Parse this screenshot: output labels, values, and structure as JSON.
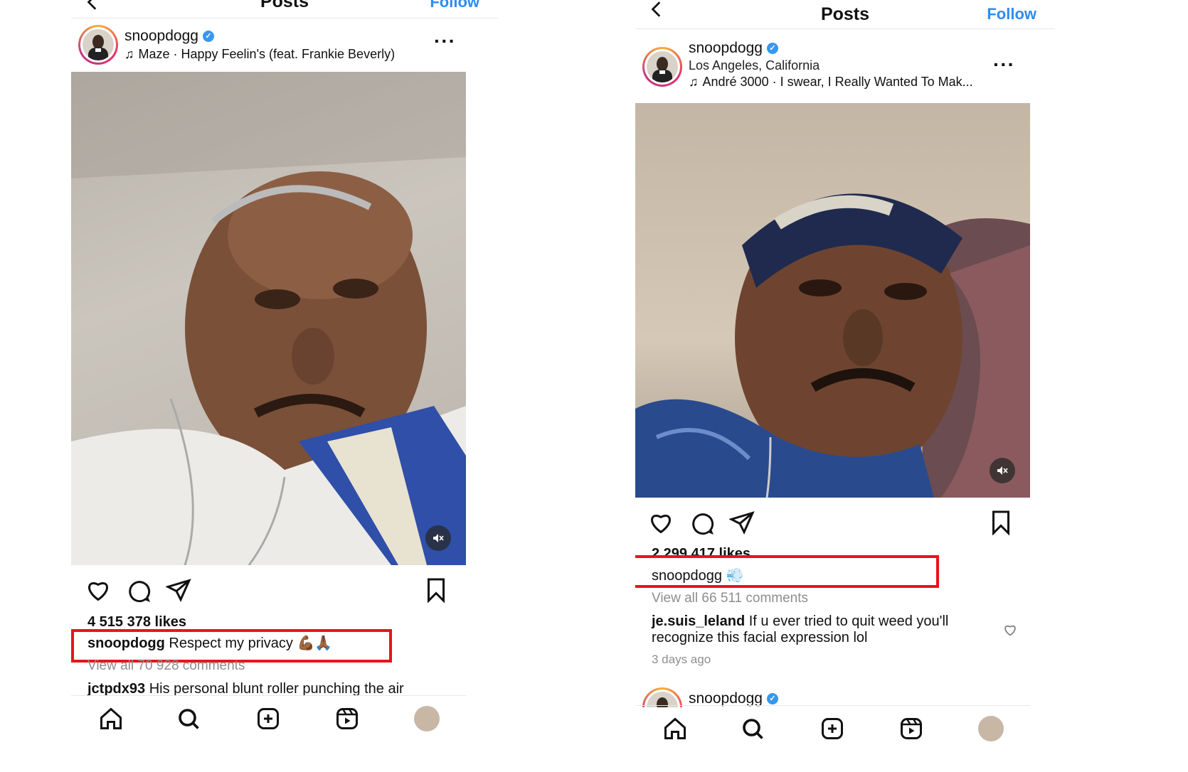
{
  "left": {
    "topbar": {
      "title": "Posts",
      "follow": "Follow"
    },
    "user": {
      "name": "snoopdogg"
    },
    "music": "Maze · Happy Feelin's (feat. Frankie Beverly)",
    "likes": "4 515 378 likes",
    "caption": {
      "user": "snoopdogg",
      "text": "Respect my privacy",
      "emoji": "💪🏾🙏🏾"
    },
    "view_all": "View all 70 928 comments",
    "comment": {
      "user": "jctpdx93",
      "text": "His personal blunt roller punching the air"
    }
  },
  "right": {
    "topbar": {
      "title": "Posts",
      "follow": "Follow"
    },
    "user": {
      "name": "snoopdogg"
    },
    "location": "Los Angeles, California",
    "music": "André 3000 · I swear, I Really Wanted To Mak...",
    "likes": "2 299 417 likes",
    "caption": {
      "user": "snoopdogg",
      "emoji": "💨"
    },
    "view_all": "View all 66 511 comments",
    "comment": {
      "user": "je.suis_leland",
      "text": "If u ever tried to quit weed you'll recognize this facial expression lol"
    },
    "time_ago": "3 days ago",
    "next_post_user": "snoopdogg"
  },
  "colors": {
    "highlight": "#e8141a",
    "accent": "#2e8cf0",
    "verified": "#3897f0"
  },
  "icons": [
    "back-icon",
    "verified-icon",
    "music-note-icon",
    "more-icon",
    "mute-icon",
    "heart-icon",
    "comment-icon",
    "share-icon",
    "bookmark-icon",
    "home-icon",
    "search-icon",
    "create-icon",
    "reels-icon",
    "profile-icon"
  ]
}
